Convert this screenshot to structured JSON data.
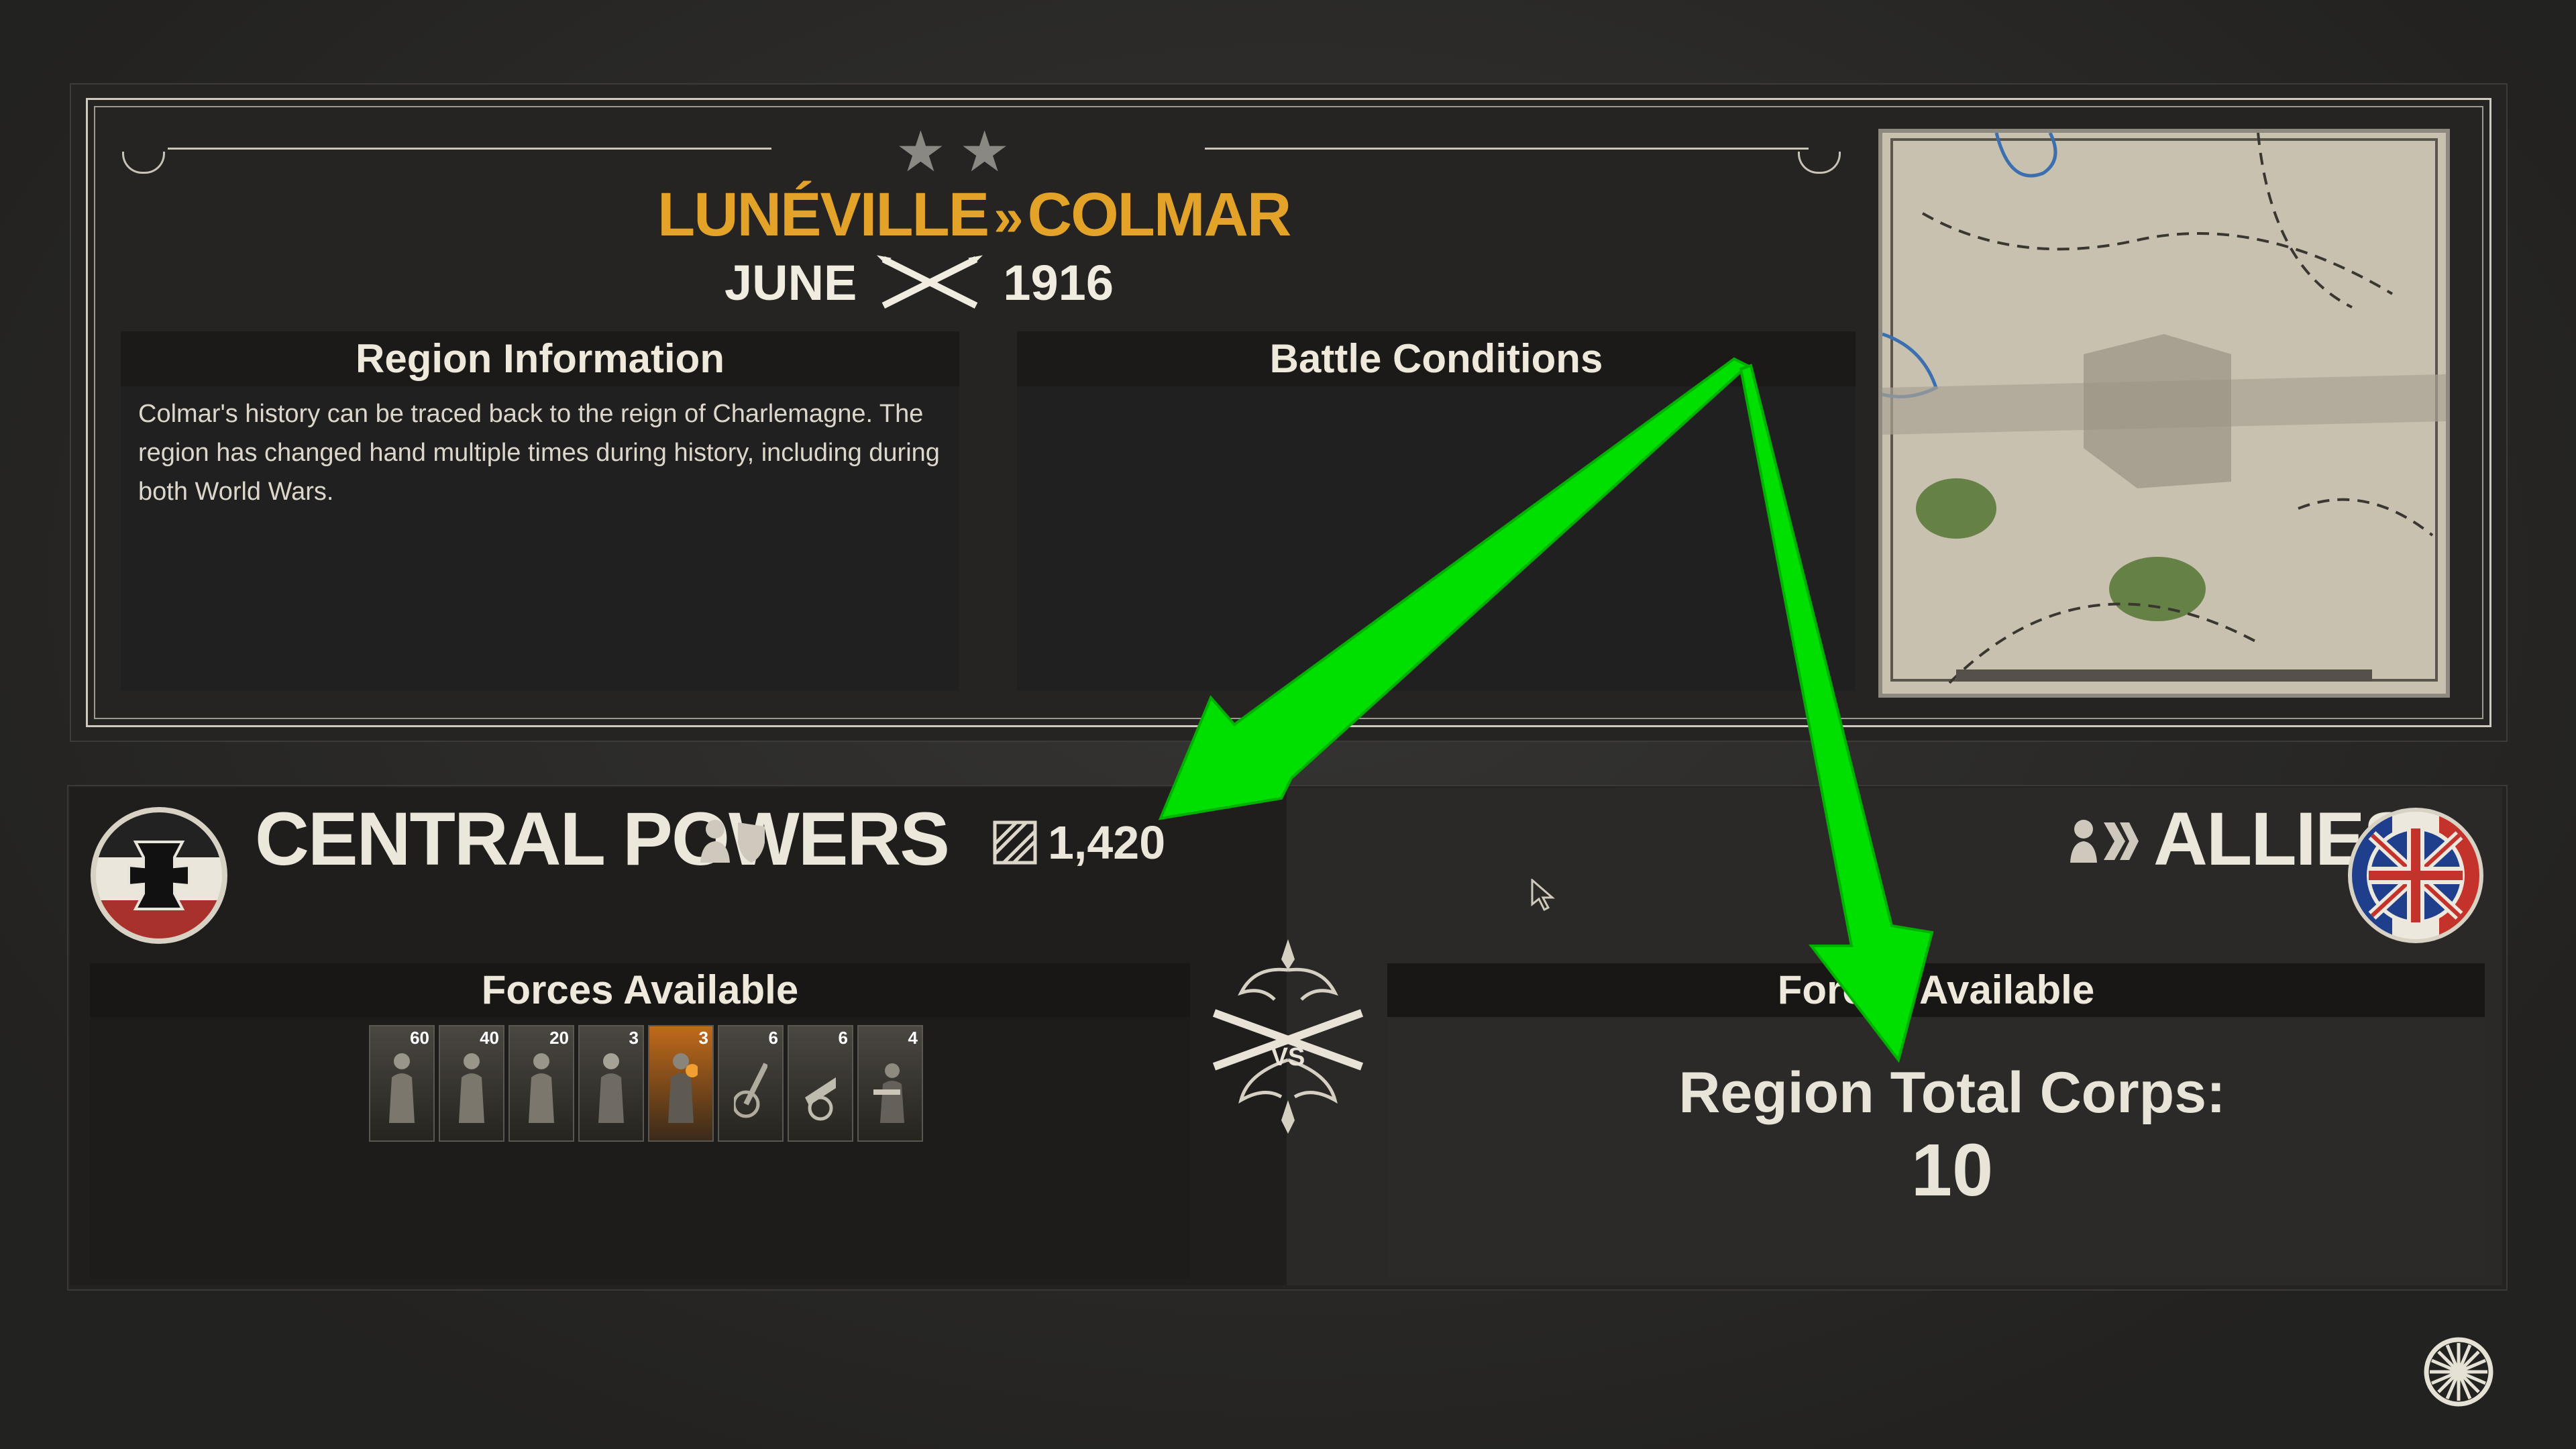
{
  "battle": {
    "stars": 2,
    "origin": "LUNÉVILLE",
    "separator": "»",
    "destination": "COLMAR",
    "month": "JUNE",
    "year": "1916"
  },
  "region_info": {
    "title": "Region Information",
    "text": "Colmar's history can be traced back to the reign of Charlemagne. The region has changed hand multiple times during history, including during both World Wars."
  },
  "battle_conditions": {
    "title": "Battle Conditions"
  },
  "central": {
    "name": "CENTRAL POWERS",
    "manpower": "1,420",
    "forces_title": "Forces Available",
    "units": [
      {
        "count": "60",
        "icon": "rifleman-icon"
      },
      {
        "count": "40",
        "icon": "rifleman-icon"
      },
      {
        "count": "20",
        "icon": "rifleman-icon"
      },
      {
        "count": "3",
        "icon": "officer-icon"
      },
      {
        "count": "3",
        "icon": "flamethrower-icon"
      },
      {
        "count": "6",
        "icon": "artillery-icon"
      },
      {
        "count": "6",
        "icon": "field-gun-icon"
      },
      {
        "count": "4",
        "icon": "machine-gun-icon"
      }
    ]
  },
  "allies": {
    "name": "ALLIES",
    "forces_title": "Forces Available",
    "region_total_label": "Region Total Corps:",
    "region_total_value": "10"
  },
  "vs_label": "VS",
  "colors": {
    "accent": "#e3a329",
    "arrow": "#00e000"
  }
}
